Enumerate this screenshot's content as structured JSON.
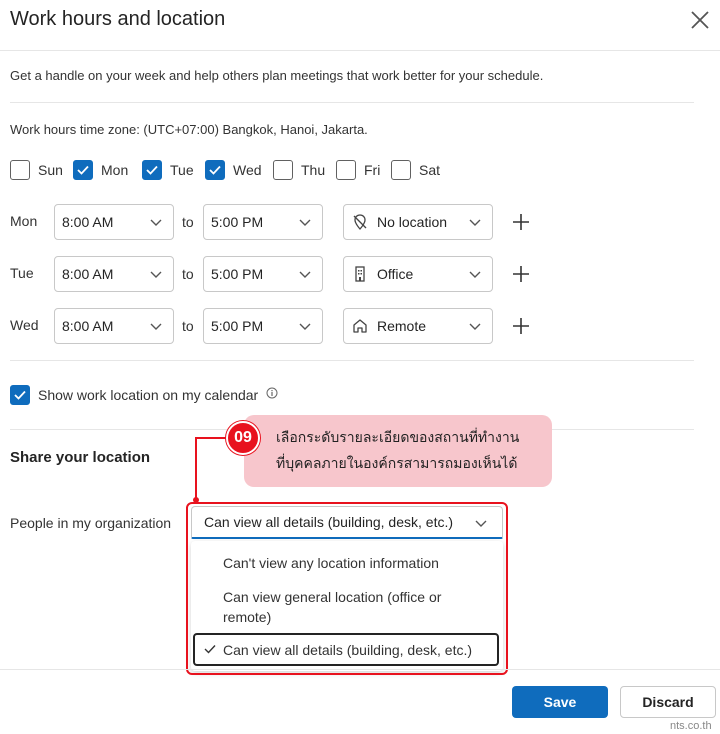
{
  "dialog": {
    "title": "Work hours and location",
    "description": "Get a handle on your week and help others plan meetings that work better for your schedule.",
    "timezone": "Work hours time zone: (UTC+07:00) Bangkok, Hanoi, Jakarta."
  },
  "days": [
    {
      "label": "Sun",
      "checked": false
    },
    {
      "label": "Mon",
      "checked": true
    },
    {
      "label": "Tue",
      "checked": true
    },
    {
      "label": "Wed",
      "checked": true
    },
    {
      "label": "Thu",
      "checked": false
    },
    {
      "label": "Fri",
      "checked": false
    },
    {
      "label": "Sat",
      "checked": false
    }
  ],
  "schedule": [
    {
      "day": "Mon",
      "start": "8:00 AM",
      "to": "to",
      "end": "5:00 PM",
      "location": "No location",
      "location_icon": "no-location-icon"
    },
    {
      "day": "Tue",
      "start": "8:00 AM",
      "to": "to",
      "end": "5:00 PM",
      "location": "Office",
      "location_icon": "building-icon"
    },
    {
      "day": "Wed",
      "start": "8:00 AM",
      "to": "to",
      "end": "5:00 PM",
      "location": "Remote",
      "location_icon": "home-icon"
    }
  ],
  "show_location": {
    "label": "Show work location on my calendar",
    "checked": true
  },
  "share": {
    "heading": "Share your location",
    "people_label": "People in my organization",
    "selected": "Can view all details (building, desk, etc.)",
    "options": [
      "Can't view any location information",
      "Can view general location (office or remote)",
      "Can view all details (building, desk, etc.)"
    ]
  },
  "annotation": {
    "step": "09",
    "line1": "เลือกระดับรายละเอียดของสถานที่ทำงาน",
    "line2": "ที่บุคคลภายในองค์กรสามารถมองเห็นได้"
  },
  "buttons": {
    "save": "Save",
    "discard": "Discard"
  },
  "watermark": "nts.co.th",
  "colors": {
    "accent": "#0f6cbd",
    "annotation_red": "#e8121e",
    "callout_pink": "#f7c6cc"
  }
}
